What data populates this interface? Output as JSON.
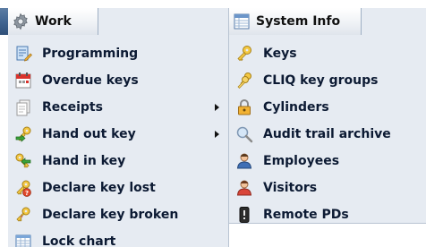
{
  "menus": {
    "work": {
      "title": "Work",
      "icon": "gear-icon",
      "items": [
        {
          "label": "Programming",
          "icon": "programming-icon"
        },
        {
          "label": "Overdue keys",
          "icon": "calendar-icon"
        },
        {
          "label": "Receipts",
          "icon": "receipts-icon",
          "has_submenu": true
        },
        {
          "label": "Hand out key",
          "icon": "hand-out-key-icon",
          "has_submenu": true
        },
        {
          "label": "Hand in key",
          "icon": "hand-in-key-icon"
        },
        {
          "label": "Declare key lost",
          "icon": "key-lost-icon"
        },
        {
          "label": "Declare key broken",
          "icon": "key-broken-icon"
        },
        {
          "label": "Lock chart",
          "icon": "lock-chart-icon"
        }
      ]
    },
    "system_info": {
      "title": "System Info",
      "icon": "system-info-icon",
      "items": [
        {
          "label": "Keys",
          "icon": "key-icon"
        },
        {
          "label": "CLIQ key groups",
          "icon": "key-groups-icon"
        },
        {
          "label": "Cylinders",
          "icon": "padlock-icon"
        },
        {
          "label": "Audit trail archive",
          "icon": "magnifier-icon"
        },
        {
          "label": "Employees",
          "icon": "employee-icon"
        },
        {
          "label": "Visitors",
          "icon": "visitor-icon"
        },
        {
          "label": "Remote PDs",
          "icon": "remote-device-icon"
        }
      ]
    }
  },
  "colors": {
    "menubar": "#3f6390",
    "menu_bg": "#e6ebf2",
    "label": "#0c1a33"
  }
}
